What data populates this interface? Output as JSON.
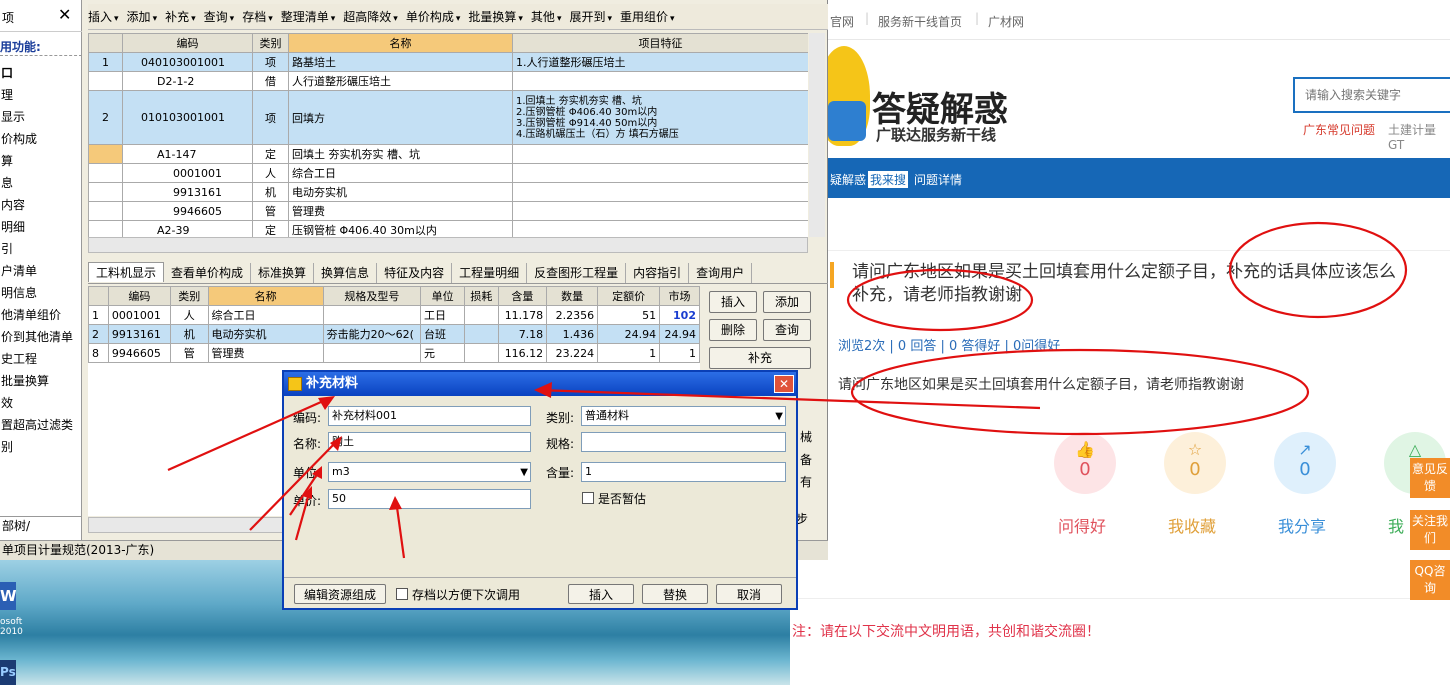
{
  "app": {
    "left_panel": {
      "close": "✕",
      "header": "项",
      "title": "用功能:",
      "items": [
        "口",
        "理",
        "显示",
        "价构成",
        "算",
        "息",
        "内容",
        "明细",
        "引",
        "户清单",
        "明信息",
        "他清单组价",
        "价到其他清单",
        "史工程",
        "批量换算",
        "效",
        "置超高过滤类别"
      ],
      "bottom_tab": "部树/"
    },
    "toolbar": [
      "插入",
      "添加",
      "补充",
      "查询",
      "存档",
      "整理清单",
      "超高降效",
      "单价构成",
      "批量换算",
      "其他",
      "展开到",
      "重用组价"
    ],
    "grid": {
      "headers": [
        "",
        "编码",
        "类别",
        "名称",
        "项目特征"
      ],
      "rows": [
        {
          "num": "1",
          "code": "040103001001",
          "type": "项",
          "name": "路基培土",
          "feature": "1.人行道整形碾压培土"
        },
        {
          "num": "",
          "code": "D2-1-2",
          "type": "借",
          "name": "人行道整形碾压培土",
          "feature": ""
        },
        {
          "num": "2",
          "code": "010103001001",
          "type": "项",
          "name": "回填方",
          "feature": "1.回填土 夯实机夯实 槽、坑"
        },
        {
          "num": "",
          "code": "A1-147",
          "type": "定",
          "name": "回填土 夯实机夯实 槽、坑",
          "feature": ""
        },
        {
          "num": "",
          "code": "0001001",
          "type": "人",
          "name": "综合工日",
          "feature": ""
        },
        {
          "num": "",
          "code": "9913161",
          "type": "机",
          "name": "电动夯实机",
          "feature": ""
        },
        {
          "num": "",
          "code": "9946605",
          "type": "管",
          "name": "管理费",
          "feature": ""
        },
        {
          "num": "",
          "code": "A2-39",
          "type": "定",
          "name": "压钢管桩 Φ406.40 30m以内",
          "feature": ""
        }
      ],
      "feature2_extra": [
        "2.压钢管桩 Φ406.40 30m以内",
        "3.压钢管桩 Φ914.40 50m以内",
        "4.压路机碾压土（石）方 填石方碾压"
      ]
    },
    "tabs": [
      "工料机显示",
      "查看单价构成",
      "标准换算",
      "换算信息",
      "特征及内容",
      "工程量明细",
      "反查图形工程量",
      "内容指引",
      "查询用户"
    ],
    "res_grid": {
      "headers": [
        "",
        "编码",
        "类别",
        "名称",
        "规格及型号",
        "单位",
        "损耗",
        "含量",
        "数量",
        "定额价",
        "市场"
      ],
      "rows": [
        [
          "1",
          "0001001",
          "人",
          "综合工日",
          "",
          "工日",
          "",
          "11.178",
          "2.2356",
          "51",
          "102"
        ],
        [
          "2",
          "9913161",
          "机",
          "电动夯实机",
          "夯击能力20～62(",
          "台班",
          "",
          "7.18",
          "1.436",
          "24.94",
          "24.94"
        ],
        [
          "8",
          "9946605",
          "管",
          "管理费",
          "",
          "元",
          "",
          "116.12",
          "23.224",
          "1",
          "1"
        ]
      ]
    },
    "side_buttons": [
      "插入",
      "添加",
      "删除",
      "查询",
      "补充"
    ],
    "side_text": [
      "械",
      "备",
      "有",
      "步"
    ],
    "status": "单项目计量规范(2013-广东)"
  },
  "dialog": {
    "title": "补充材料",
    "close": "✕",
    "code_label": "编码:",
    "code_value": "补充材料001",
    "name_label": "名称:",
    "name_value": "购土",
    "unit_label": "单位:",
    "unit_value": "m3",
    "price_label": "单价:",
    "price_value": "50",
    "type_label": "类别:",
    "type_value": "普通材料",
    "spec_label": "规格:",
    "spec_value": "",
    "content_label": "含量:",
    "content_value": "1",
    "temp_label": "是否暂估",
    "edit_button": "编辑资源组成",
    "save_label": "存档以方便下次调用",
    "insert_button": "插入",
    "replace_button": "替换",
    "cancel_button": "取消"
  },
  "desktop": {
    "icon_text": "osoft\n2010",
    "taskbar": "Ps"
  },
  "web": {
    "nav": [
      "官网",
      "服务新干线首页",
      "广材网"
    ],
    "logo_title": "答疑解惑",
    "logo_sub": "广联达服务新干线",
    "search_placeholder": "请输入搜索关键字",
    "hot_links": [
      "广东常见问题",
      "土建计量GT"
    ],
    "breadcrumb": [
      "疑解惑",
      "我来搜",
      "问题详情"
    ],
    "question_title": "请问广东地区如果是买土回填套用什么定额子目，补充的话具体应该怎么补充，请老师指教谢谢",
    "stats": "浏览2次 | 0 回答 | 0 答得好 | 0问得好",
    "question_body": "请问广东地区如果是买土回填套用什么定额子目，请老师指教谢谢",
    "actions": [
      {
        "label": "问得好",
        "count": "0",
        "color": "#e0525d",
        "bg": "#fde4e6",
        "icon": "👍"
      },
      {
        "label": "我收藏",
        "count": "0",
        "color": "#e0a03a",
        "bg": "#fdf0da",
        "icon": "☆"
      },
      {
        "label": "我分享",
        "count": "0",
        "color": "#3a8fd8",
        "bg": "#dff0fc",
        "icon": "↗"
      },
      {
        "label": "我",
        "count": "",
        "color": "#3fae5a",
        "bg": "#e0f5e4",
        "icon": "△"
      }
    ],
    "side_float": [
      "意见反馈",
      "关注我们",
      "QQ咨询"
    ],
    "notice": "注：请在以下交流中文明用语，共创和谐交流圈！"
  }
}
